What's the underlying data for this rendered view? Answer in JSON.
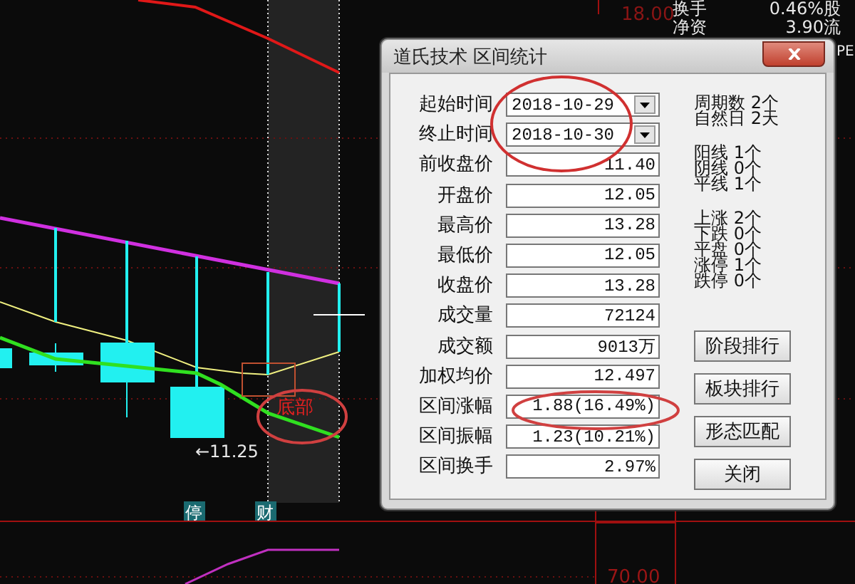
{
  "chart": {
    "top_axis_label": "18.00",
    "low_marker": "←11.25",
    "signal_label": "底部",
    "bottom_axis_label": "70.00",
    "badges": [
      "停",
      "财"
    ]
  },
  "info_panel": {
    "rows": [
      {
        "label": "换手",
        "value": "0.46%",
        "unit": "股"
      },
      {
        "label": "净资",
        "value": "3.90",
        "unit": "流"
      }
    ],
    "cut_label": "PE"
  },
  "dialog": {
    "title": "道氏技术 区间统计",
    "fields": [
      {
        "label": "起始时间",
        "value": "2018-10-29",
        "kind": "date"
      },
      {
        "label": "终止时间",
        "value": "2018-10-30",
        "kind": "date"
      },
      {
        "label": "前收盘价",
        "value": "11.40",
        "kind": "number"
      },
      {
        "label": "开盘价",
        "value": "12.05",
        "kind": "number"
      },
      {
        "label": "最高价",
        "value": "13.28",
        "kind": "number"
      },
      {
        "label": "最低价",
        "value": "12.05",
        "kind": "number"
      },
      {
        "label": "收盘价",
        "value": "13.28",
        "kind": "number"
      },
      {
        "label": "成交量",
        "value": "72124",
        "kind": "number"
      },
      {
        "label": "成交额",
        "value": "9013万",
        "kind": "number"
      },
      {
        "label": "加权均价",
        "value": "12.497",
        "kind": "number"
      },
      {
        "label": "区间涨幅",
        "value": "1.88(16.49%)",
        "kind": "number"
      },
      {
        "label": "区间振幅",
        "value": "1.23(10.21%)",
        "kind": "number"
      },
      {
        "label": "区间换手",
        "value": "2.97%",
        "kind": "number"
      }
    ],
    "stat_groups": [
      [
        {
          "label": "周期数",
          "value": "2个"
        },
        {
          "label": "自然日",
          "value": "2天"
        }
      ],
      [
        {
          "label": "阳线",
          "value": "1个"
        },
        {
          "label": "阴线",
          "value": "0个"
        },
        {
          "label": "平线",
          "value": "1个"
        }
      ],
      [
        {
          "label": "上涨",
          "value": "2个"
        },
        {
          "label": "下跌",
          "value": "0个"
        },
        {
          "label": "平盘",
          "value": "0个"
        },
        {
          "label": "涨停",
          "value": "1个"
        },
        {
          "label": "跌停",
          "value": "0个"
        }
      ]
    ],
    "buttons": [
      "阶段排行",
      "板块排行",
      "形态匹配",
      "关闭"
    ]
  }
}
